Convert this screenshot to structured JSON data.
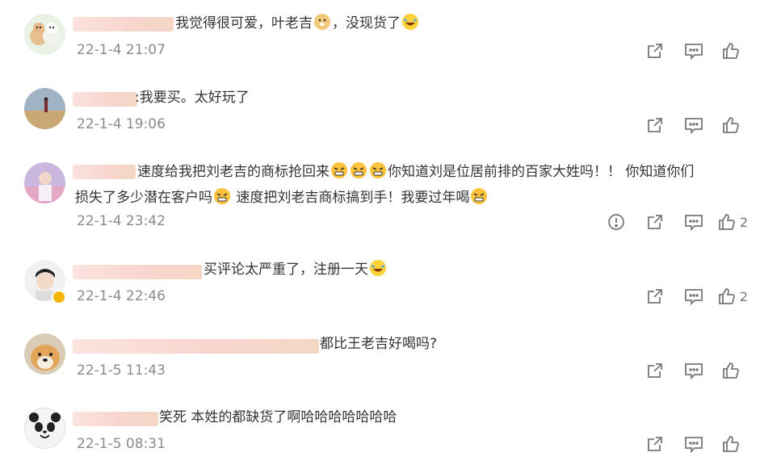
{
  "comments": [
    {
      "text": "我觉得很可爱，叶老吉",
      "text_after": "，没现货了",
      "time": "22-1-4 21:07",
      "likes": ""
    },
    {
      "text": ":我要买。太好玩了",
      "time": "22-1-4 19:06",
      "likes": ""
    },
    {
      "text_line1_a": "速度给我把刘老吉的商标抢回来",
      "text_line1_b": "你知道刘是位居前排的百家大姓吗！！ 你知道你们",
      "text_line2_a": "损失了多少潜在客户吗",
      "text_line2_b": "速度把刘老吉商标搞到手！我要过年喝",
      "time": "22-1-4 23:42",
      "likes": "2"
    },
    {
      "text": "买评论太严重了，注册一天",
      "time": "22-1-4 22:46",
      "likes": "2"
    },
    {
      "text": "都比王老吉好喝吗?",
      "time": "22-1-5 11:43",
      "likes": ""
    },
    {
      "text": "笑死 本姓的都缺货了啊哈哈哈哈哈哈哈",
      "time": "22-1-5 08:31",
      "likes": ""
    }
  ],
  "icons": {
    "share": "share-icon",
    "comment": "comment-icon",
    "like": "thumbs-up-icon",
    "report": "report-icon"
  }
}
